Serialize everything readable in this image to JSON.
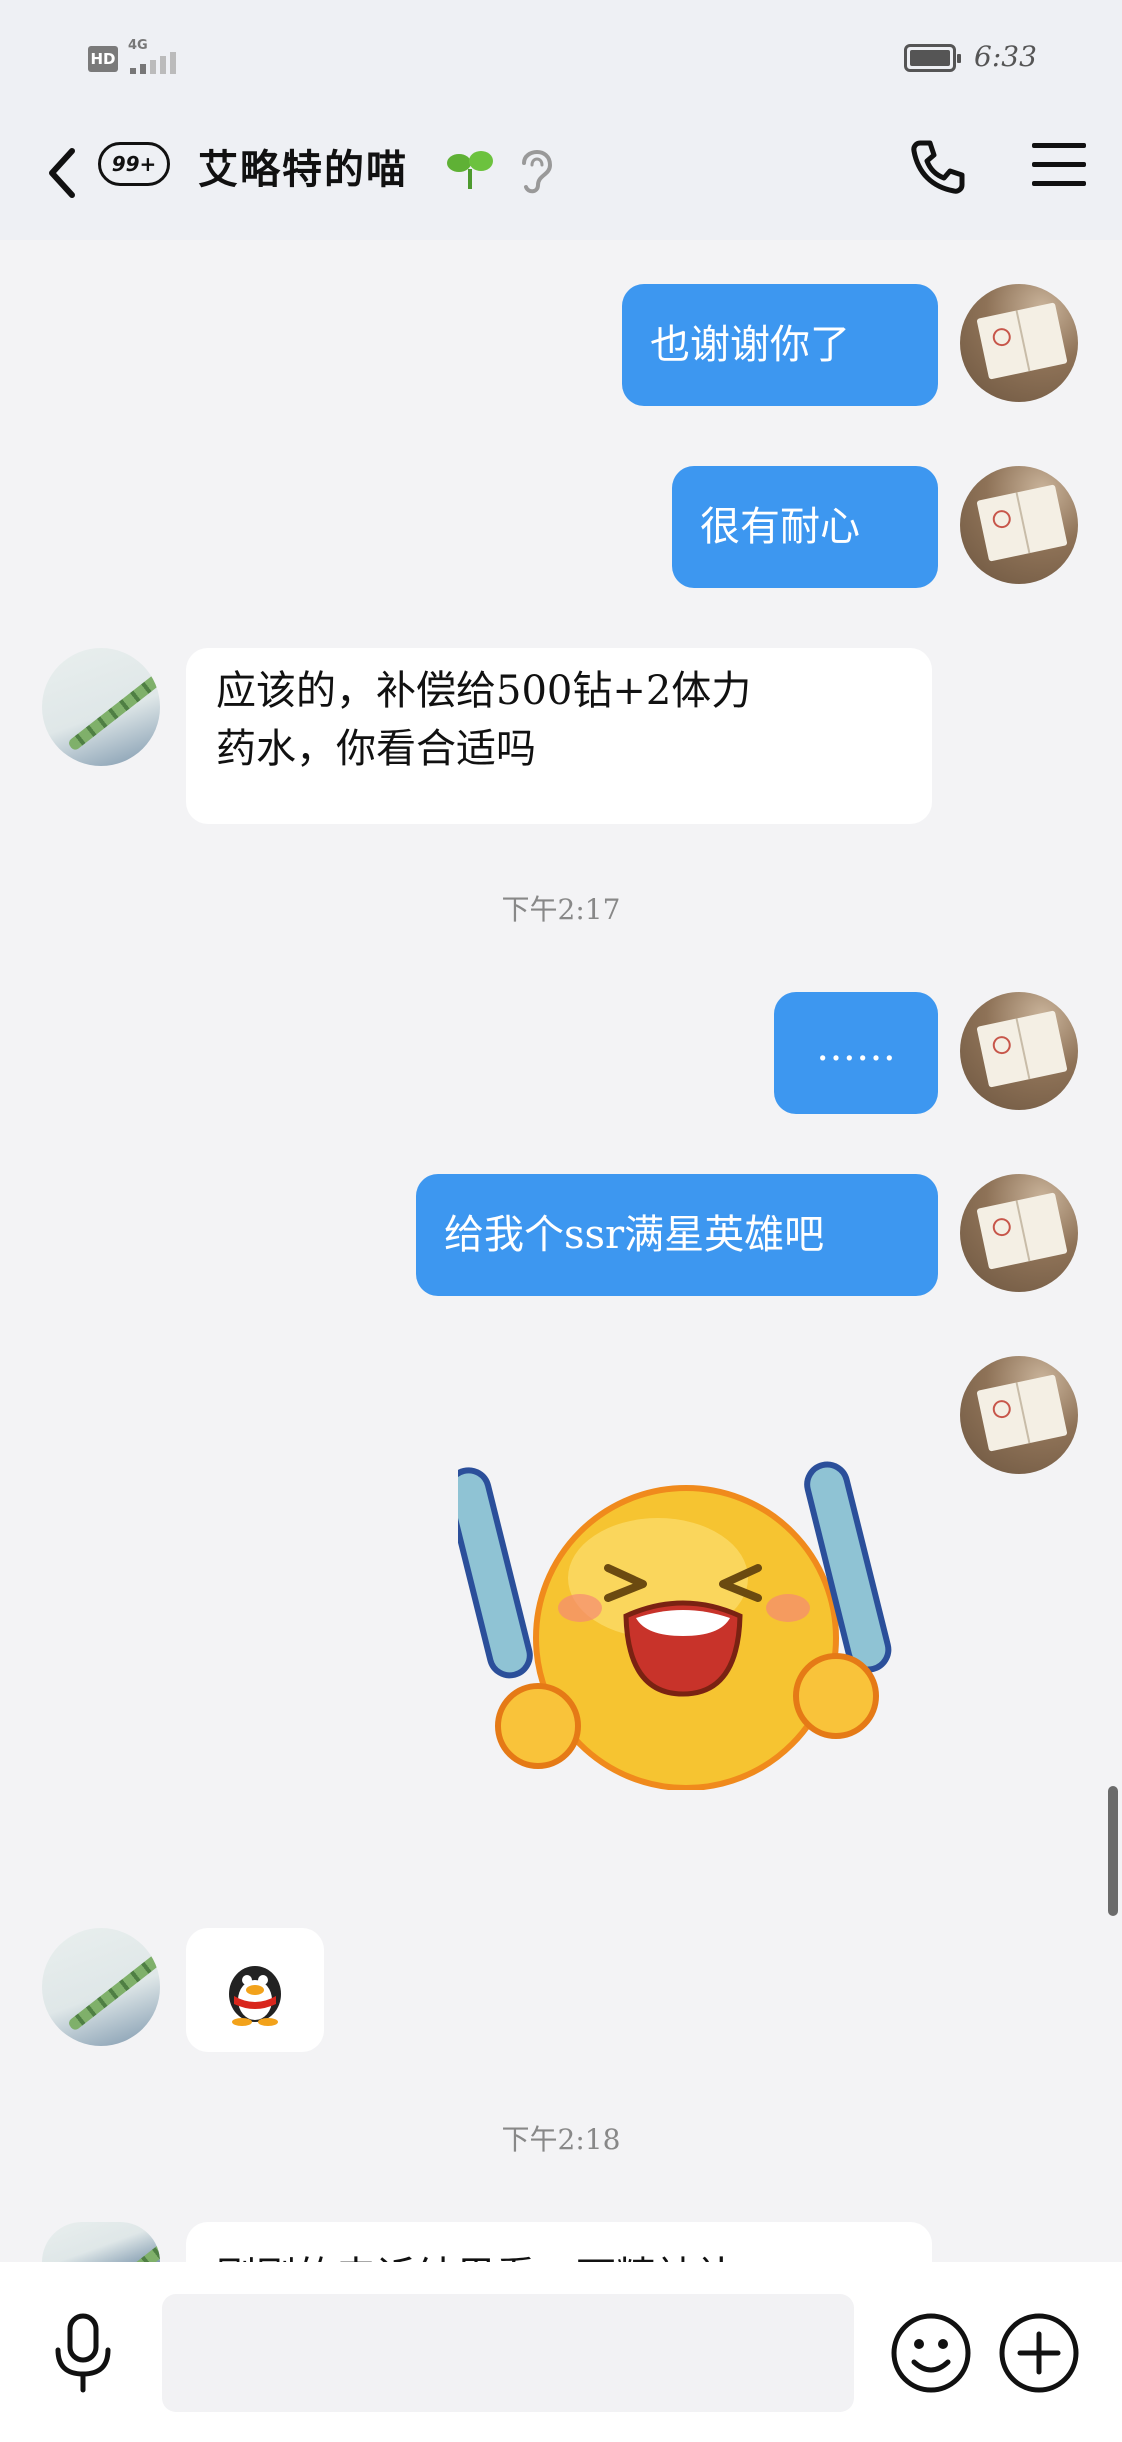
{
  "status_bar": {
    "hd_label": "HD",
    "network_label": "4G",
    "time": "6:33"
  },
  "header": {
    "unread_badge": "99+",
    "title": "艾略特的喵",
    "icons": [
      "back-icon",
      "sprout-icon",
      "ear-icon",
      "phone-icon",
      "menu-icon"
    ]
  },
  "messages": [
    {
      "sender": "self",
      "text": "也谢谢你了"
    },
    {
      "sender": "self",
      "text": "很有耐心"
    },
    {
      "sender": "peer",
      "lines": [
        "应该的，补偿给500钻+2体力",
        "药水，你看合适吗"
      ]
    },
    {
      "sender": "self",
      "text": "……"
    },
    {
      "sender": "self",
      "text": "给我个ssr满星英雄吧"
    },
    {
      "sender": "self",
      "type": "sticker",
      "sticker": "cheering-emoji-sticker"
    },
    {
      "sender": "peer",
      "type": "sticker",
      "sticker": "qq-penguin-sticker"
    },
    {
      "sender": "peer",
      "text": "刚刚的申诉结果看一下精神补..."
    }
  ],
  "timestamps": [
    "下午2:17",
    "下午2:18"
  ],
  "input_bar": {
    "placeholder": "",
    "icons": [
      "mic-icon",
      "emoji-icon",
      "plus-icon"
    ]
  },
  "colors": {
    "self_bubble": "#3d97f0",
    "peer_bubble": "#ffffff",
    "background": "#f3f3f5",
    "header": "#eef0f4"
  }
}
